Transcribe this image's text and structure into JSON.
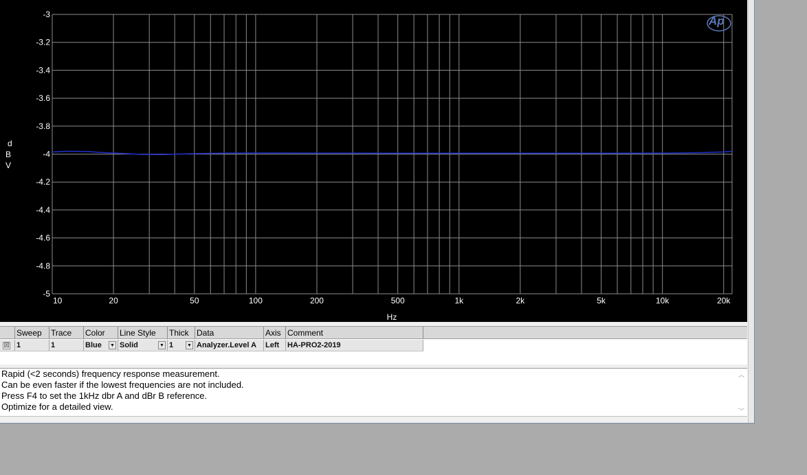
{
  "graph": {
    "y_axis_letters": [
      "d",
      "B",
      "V"
    ],
    "x_axis_title": "Hz",
    "logo_text": "Ap",
    "background": "#000000",
    "grid_color": "#8c8c8c",
    "trace_color": "#2030d0"
  },
  "chart_data": {
    "type": "line",
    "title": "",
    "xlabel": "Hz",
    "ylabel": "dBV",
    "x_scale": "log",
    "xlim": [
      10,
      22000
    ],
    "ylim": [
      -5,
      -3
    ],
    "grid": true,
    "x_ticks": [
      {
        "value": 10,
        "label": "10"
      },
      {
        "value": 20,
        "label": "20"
      },
      {
        "value": 50,
        "label": "50"
      },
      {
        "value": 100,
        "label": "100"
      },
      {
        "value": 200,
        "label": "200"
      },
      {
        "value": 500,
        "label": "500"
      },
      {
        "value": 1000,
        "label": "1k"
      },
      {
        "value": 2000,
        "label": "2k"
      },
      {
        "value": 5000,
        "label": "5k"
      },
      {
        "value": 10000,
        "label": "10k"
      },
      {
        "value": 20000,
        "label": "20k"
      }
    ],
    "y_ticks": [
      {
        "value": -3,
        "label": "-3"
      },
      {
        "value": -3.2,
        "label": "-3.2"
      },
      {
        "value": -3.4,
        "label": "-3.4"
      },
      {
        "value": -3.6,
        "label": "-3.6"
      },
      {
        "value": -3.8,
        "label": "-3.8"
      },
      {
        "value": -4,
        "label": "-4"
      },
      {
        "value": -4.2,
        "label": "-4.2"
      },
      {
        "value": -4.4,
        "label": "-4.4"
      },
      {
        "value": -4.6,
        "label": "-4.6"
      },
      {
        "value": -4.8,
        "label": "-4.8"
      },
      {
        "value": -5,
        "label": "-5"
      }
    ],
    "series": [
      {
        "color": "#2030d0",
        "x": [
          10,
          12,
          15,
          18,
          22,
          27,
          35,
          50,
          70,
          100,
          200,
          500,
          1000,
          2000,
          5000,
          10000,
          15000,
          20000,
          22000
        ],
        "y": [
          -3.985,
          -3.98,
          -3.982,
          -3.99,
          -3.995,
          -4.002,
          -4.003,
          -3.997,
          -3.993,
          -3.992,
          -3.993,
          -3.994,
          -3.994,
          -3.994,
          -3.994,
          -3.993,
          -3.99,
          -3.985,
          -3.98
        ]
      }
    ]
  },
  "trace_table": {
    "headers": {
      "sweep": "Sweep",
      "trace": "Trace",
      "color": "Color",
      "line_style": "Line Style",
      "thick": "Thick",
      "data": "Data",
      "axis": "Axis",
      "comment": "Comment"
    },
    "row": {
      "checkbox": "☒",
      "sweep": "1",
      "trace": "1",
      "color": "Blue",
      "line_style": "Solid",
      "thick": "1",
      "data": "Analyzer.Level A",
      "axis": "Left",
      "comment": "HA-PRO2-2019"
    }
  },
  "comment_lines": [
    "Rapid (<2 seconds) frequency response measurement.",
    "Can be even faster if the lowest frequencies are not included.",
    "Press F4 to set the 1kHz dbr A and dBr B reference.",
    "Optimize for a detailed view."
  ]
}
